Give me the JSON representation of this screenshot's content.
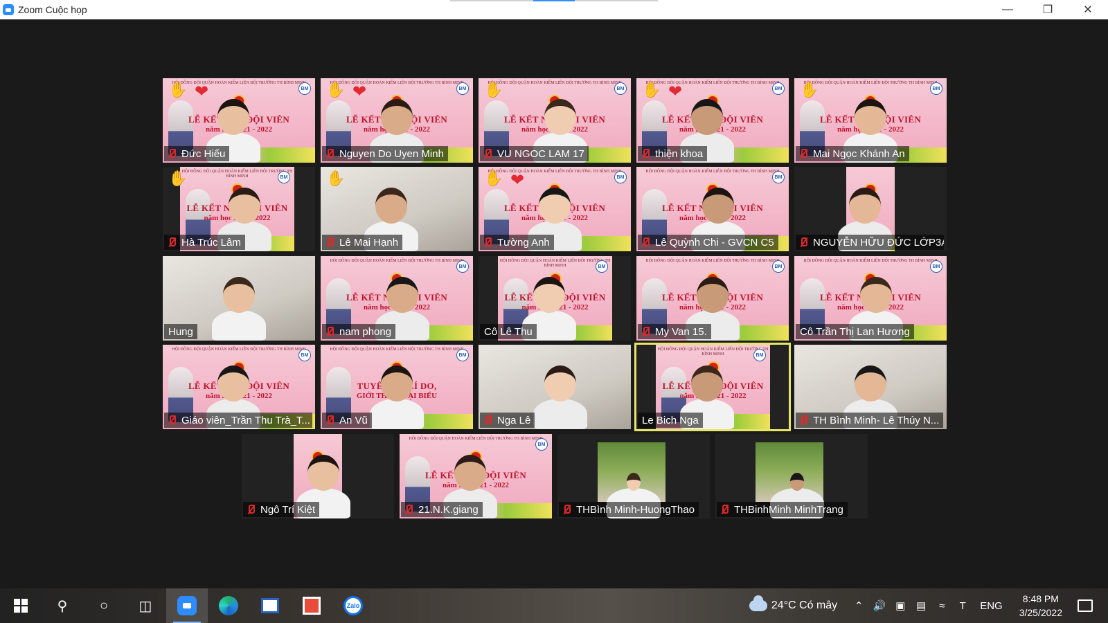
{
  "window": {
    "title": "Zoom Cuộc họp"
  },
  "participants": [
    {
      "name": "Đức Hiếu",
      "banner": "lien",
      "hand": true,
      "heart": true
    },
    {
      "name": "Nguyen Do Uyen Minh",
      "banner": "lien",
      "hand": true,
      "heart": true
    },
    {
      "name": "VU NGOC LAM  17",
      "banner": "lien",
      "hand": true,
      "heart": false
    },
    {
      "name": "thiện khoa",
      "banner": "ket",
      "hand": true,
      "heart": true
    },
    {
      "name": "Mai Ngọc Khánh An",
      "banner": "ket",
      "hand": true,
      "heart": false
    },
    {
      "name": "Hà Trúc Lâm",
      "banner": "lien",
      "hand": true,
      "heart": false
    },
    {
      "name": "Lê Mai Hạnh",
      "banner": "room",
      "hand": true,
      "heart": false
    },
    {
      "name": "Tường Anh",
      "banner": "ket",
      "hand": true,
      "heart": true,
      "hand_dark": true
    },
    {
      "name": "Lê Quỳnh Chi - GVCN C5",
      "banner": "lien",
      "hand": false,
      "heart": false
    },
    {
      "name": "NGUYỄN HỮU ĐỨC LỚP3A",
      "banner": "portrait",
      "hand": false,
      "heart": false
    },
    {
      "name": "Hung",
      "banner": "room",
      "hand": false,
      "heart": false,
      "muted": false
    },
    {
      "name": "nam phong",
      "banner": "ket",
      "hand": false,
      "heart": false
    },
    {
      "name": "Cô Lê Thu",
      "banner": "ket",
      "hand": false,
      "heart": false,
      "muted": false
    },
    {
      "name": "My Van 15.",
      "banner": "lien",
      "hand": false,
      "heart": false
    },
    {
      "name": "Cô Trần Thị Lan Hương",
      "banner": "ket",
      "hand": false,
      "heart": false,
      "muted": false
    },
    {
      "name": "Giáo viên_Trần Thu Trà_T...",
      "banner": "ket",
      "hand": false,
      "heart": false
    },
    {
      "name": "An Vũ",
      "banner": "tuyen",
      "hand": false,
      "heart": false
    },
    {
      "name": "Nga Lê",
      "banner": "room",
      "hand": false,
      "heart": false
    },
    {
      "name": "Le Bich Nga",
      "banner": "ket",
      "hand": false,
      "heart": false,
      "muted": false,
      "active": true
    },
    {
      "name": "TH Bình Minh- Lê Thúy N...",
      "banner": "room",
      "hand": false,
      "heart": false
    },
    {
      "name": "Ngô Trí Kiệt",
      "banner": "portrait",
      "hand": false,
      "heart": false
    },
    {
      "name": "21.N.K.giang",
      "banner": "lien",
      "hand": false,
      "heart": false
    },
    {
      "name": "THBình Minh-HuongThao",
      "banner": "photo",
      "hand": false,
      "heart": false
    },
    {
      "name": "THBinhMinh MinhTrang",
      "banner": "photo",
      "hand": false,
      "heart": false
    }
  ],
  "banner_text": {
    "header": "HỘI ĐỒNG ĐỘI QUẬN HOÀN KIẾM",
    "header2": "LIÊN ĐỘI TRƯỜNG TH BÌNH MINH",
    "lien": "LỄ KẾT NẠP ĐỘI VIÊN",
    "ket": "LỄ KẾT NẠP ĐỘI VIÊN",
    "year": "năm học 2021 - 2022",
    "tuyen": "TUYÊN BỐ LÍ DO,",
    "tuyen2": "GIỚI THIỆU ĐẠI BIỂU",
    "bm": "BM"
  },
  "taskbar": {
    "weather": "24°C  Có mây",
    "lang": "ENG",
    "time": "8:48 PM",
    "date": "3/25/2022",
    "zalo": "Zalo"
  },
  "colors": {
    "muted_mic": "#e02828",
    "active_speaker": "#e7e66a",
    "banner_pink": "#f6c9d6",
    "zoom_blue": "#2d8cff"
  }
}
